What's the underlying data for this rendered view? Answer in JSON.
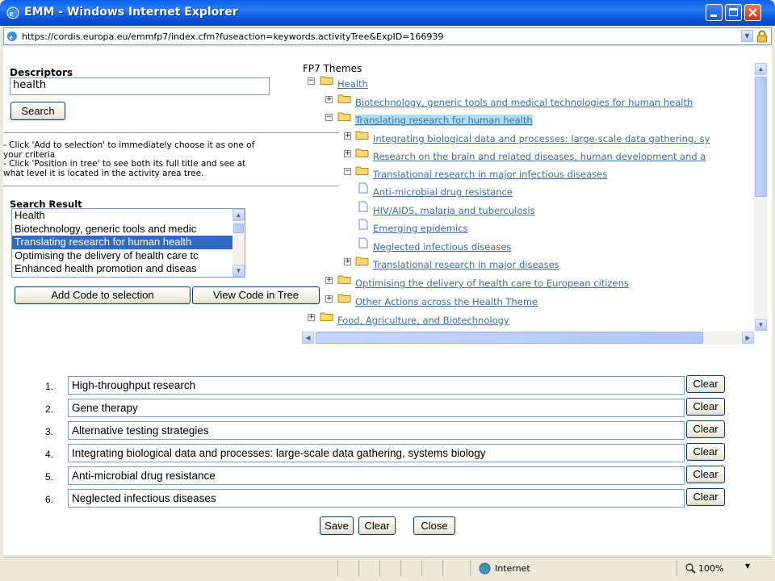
{
  "window": {
    "title": "EMM - Windows Internet Explorer"
  },
  "address_bar": {
    "url": "https://cordis.europa.eu/emmfp7/index.cfm?fuseaction=keywords.activityTree&ExpID=166939"
  },
  "descriptors": {
    "label": "Descriptors",
    "value": "health",
    "search_button": "Search"
  },
  "help_text": {
    "line1": "- Click 'Add to selection' to immediately choose it as one of",
    "line2": "your criteria",
    "line3": "- Click 'Position in tree' to see both its full title and see at",
    "line4": "what level it is located in the activity area tree."
  },
  "search_result": {
    "label": "Search Result",
    "items": [
      "Health",
      "Biotechnology, generic tools and medic",
      "Translating research for human health",
      "Optimising the delivery of health care tc",
      "Enhanced health promotion and diseas"
    ],
    "selected_index": 2,
    "add_button": "Add Code to selection",
    "view_button": "View Code in Tree"
  },
  "tree": {
    "title": "FP7 Themes",
    "nodes": [
      "Health",
      "Biotechnology, generic tools and medical technologies for human health",
      "Translating research for human health",
      "Integrating biological data and processes: large-scale data gathering, sy",
      "Research on the brain and related diseases, human development and a",
      "Translational research in major infectious diseases",
      "Anti-microbial drug resistance",
      "HIV/AIDS, malaria and tuberculosis",
      "Emerging epidemics",
      "Neglected infectious diseases",
      "Translational research in major diseases",
      "Optimising the delivery of health care to European citizens",
      "Other Actions across the Health Theme",
      "Food, Agriculture, and Biotechnology"
    ],
    "selected_node": "Translating research for human health"
  },
  "selection": {
    "items": [
      {
        "num": "1.",
        "value": "High-throughput research"
      },
      {
        "num": "2.",
        "value": "Gene therapy"
      },
      {
        "num": "3.",
        "value": "Alternative testing strategies"
      },
      {
        "num": "4.",
        "value": "Integrating biological data and processes: large-scale data gathering, systems biology"
      },
      {
        "num": "5.",
        "value": "Anti-microbial drug resistance"
      },
      {
        "num": "6.",
        "value": "Neglected infectious diseases"
      }
    ],
    "clear_label": "Clear"
  },
  "footer_buttons": {
    "save": "Save",
    "clear": "Clear",
    "close": "Close"
  },
  "statusbar": {
    "zone": "Internet",
    "zoom": "100%"
  },
  "colors": {
    "titlebar": "#0a55da",
    "link": "#3c6e9e",
    "selected_bg": "#316ac5",
    "tree_selected_bg": "#aee0f4"
  }
}
